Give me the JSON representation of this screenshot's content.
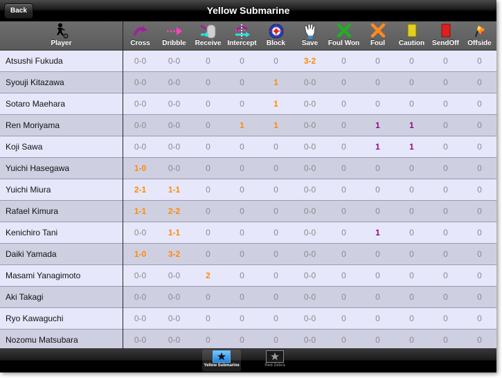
{
  "navbar": {
    "back_label": "Back",
    "title": "Yellow Submarine"
  },
  "header": {
    "player_label": "Player",
    "player_icon": "soccer-player-icon",
    "columns": [
      {
        "key": "cross",
        "label": "Cross",
        "icon": "cross-arrow-icon"
      },
      {
        "key": "dribble",
        "label": "Dribble",
        "icon": "dribble-arrow-icon"
      },
      {
        "key": "receive",
        "label": "Receive",
        "icon": "receive-icon"
      },
      {
        "key": "intercept",
        "label": "Intercept",
        "icon": "intercept-icon"
      },
      {
        "key": "block",
        "label": "Block",
        "icon": "block-target-icon"
      },
      {
        "key": "save",
        "label": "Save",
        "icon": "goalkeeper-glove-icon"
      },
      {
        "key": "foul_won",
        "label": "Foul Won",
        "icon": "green-x-icon"
      },
      {
        "key": "foul",
        "label": "Foul",
        "icon": "orange-x-icon"
      },
      {
        "key": "caution",
        "label": "Caution",
        "icon": "yellow-card-icon"
      },
      {
        "key": "sendoff",
        "label": "SendOff",
        "icon": "red-card-icon"
      },
      {
        "key": "offside",
        "label": "Offside",
        "icon": "offside-flag-icon"
      }
    ]
  },
  "colors": {
    "highlight_orange": "#ff8a00",
    "highlight_purple": "#8a0a8a",
    "zero_gray": "#8a8a8a",
    "row_light": "#e7e7fb",
    "row_dark": "#cfcfe2",
    "tab_active": "#3aa0f0"
  },
  "players": [
    {
      "name": "Atsushi Fukuda",
      "stats": [
        "0-0",
        "0-0",
        "0",
        "0",
        "0",
        "3-2",
        "0",
        "0",
        "0",
        "0",
        "0"
      ]
    },
    {
      "name": "Syouji Kitazawa",
      "stats": [
        "0-0",
        "0-0",
        "0",
        "0",
        "1",
        "0-0",
        "0",
        "0",
        "0",
        "0",
        "0"
      ]
    },
    {
      "name": "Sotaro Maehara",
      "stats": [
        "0-0",
        "0-0",
        "0",
        "0",
        "1",
        "0-0",
        "0",
        "0",
        "0",
        "0",
        "0"
      ]
    },
    {
      "name": "Ren Moriyama",
      "stats": [
        "0-0",
        "0-0",
        "0",
        "1",
        "1",
        "0-0",
        "0",
        "1",
        "1",
        "0",
        "0"
      ]
    },
    {
      "name": "Koji Sawa",
      "stats": [
        "0-0",
        "0-0",
        "0",
        "0",
        "0",
        "0-0",
        "0",
        "1",
        "1",
        "0",
        "0"
      ]
    },
    {
      "name": "Yuichi Hasegawa",
      "stats": [
        "1-0",
        "0-0",
        "0",
        "0",
        "0",
        "0-0",
        "0",
        "0",
        "0",
        "0",
        "0"
      ]
    },
    {
      "name": "Yuichi Miura",
      "stats": [
        "2-1",
        "1-1",
        "0",
        "0",
        "0",
        "0-0",
        "0",
        "0",
        "0",
        "0",
        "0"
      ]
    },
    {
      "name": "Rafael Kimura",
      "stats": [
        "1-1",
        "2-2",
        "0",
        "0",
        "0",
        "0-0",
        "0",
        "0",
        "0",
        "0",
        "0"
      ]
    },
    {
      "name": "Kenichiro Tani",
      "stats": [
        "0-0",
        "1-1",
        "0",
        "0",
        "0",
        "0-0",
        "0",
        "1",
        "0",
        "0",
        "0"
      ]
    },
    {
      "name": "Daiki Yamada",
      "stats": [
        "1-0",
        "3-2",
        "0",
        "0",
        "0",
        "0-0",
        "0",
        "0",
        "0",
        "0",
        "0"
      ]
    },
    {
      "name": "Masami Yanagimoto",
      "stats": [
        "0-0",
        "0-0",
        "2",
        "0",
        "0",
        "0-0",
        "0",
        "0",
        "0",
        "0",
        "0"
      ]
    },
    {
      "name": "Aki Takagi",
      "stats": [
        "0-0",
        "0-0",
        "0",
        "0",
        "0",
        "0-0",
        "0",
        "0",
        "0",
        "0",
        "0"
      ]
    },
    {
      "name": "Ryo Kawaguchi",
      "stats": [
        "0-0",
        "0-0",
        "0",
        "0",
        "0",
        "0-0",
        "0",
        "0",
        "0",
        "0",
        "0"
      ]
    },
    {
      "name": "Nozomu Matsubara",
      "stats": [
        "0-0",
        "0-0",
        "0",
        "0",
        "0",
        "0-0",
        "0",
        "0",
        "0",
        "0",
        "0"
      ]
    }
  ],
  "tabbar": {
    "tabs": [
      {
        "label": "Yellow Submarine",
        "icon": "star-icon",
        "active": true
      },
      {
        "label": "Red Zebra",
        "icon": "star-icon",
        "active": false
      }
    ]
  }
}
